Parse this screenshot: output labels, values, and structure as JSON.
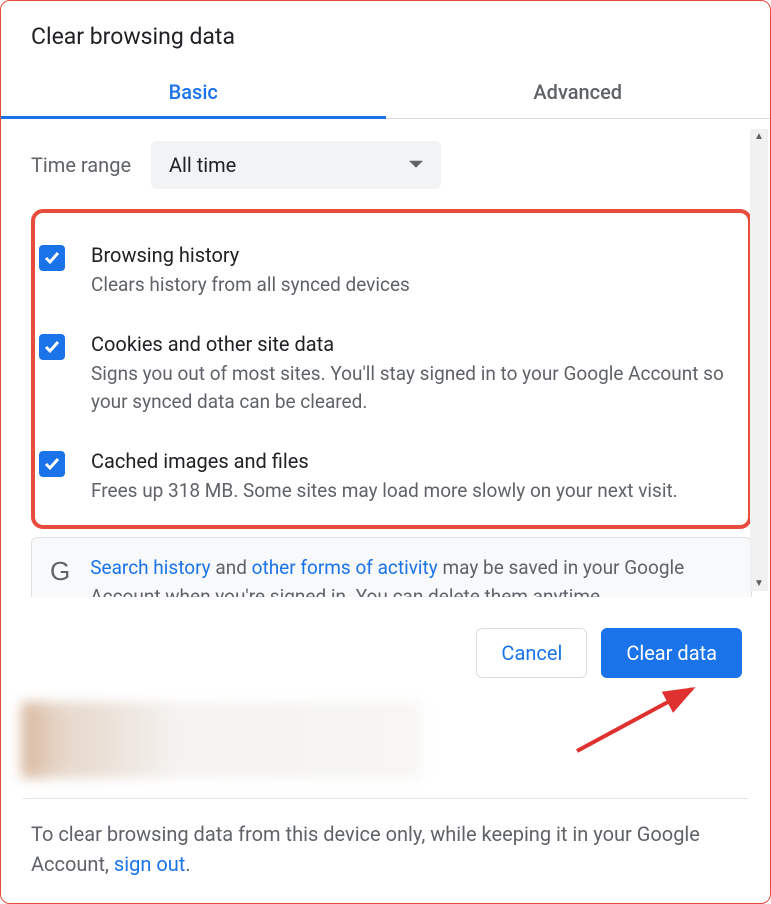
{
  "title": "Clear browsing data",
  "tabs": {
    "basic": "Basic",
    "advanced": "Advanced"
  },
  "time": {
    "label": "Time range",
    "value": "All time"
  },
  "items": [
    {
      "title": "Browsing history",
      "desc": "Clears history from all synced devices"
    },
    {
      "title": "Cookies and other site data",
      "desc": "Signs you out of most sites. You'll stay signed in to your Google Account so your synced data can be cleared."
    },
    {
      "title": "Cached images and files",
      "desc": "Frees up 318 MB. Some sites may load more slowly on your next visit."
    }
  ],
  "info": {
    "link1": "Search history",
    "mid1": " and ",
    "link2": "other forms of activity",
    "rest": " may be saved in your Google Account when you're signed in. You can delete them anytime."
  },
  "buttons": {
    "cancel": "Cancel",
    "clear": "Clear data"
  },
  "footer": {
    "text": "To clear browsing data from this device only, while keeping it in your Google Account, ",
    "link": "sign out",
    "dot": "."
  }
}
